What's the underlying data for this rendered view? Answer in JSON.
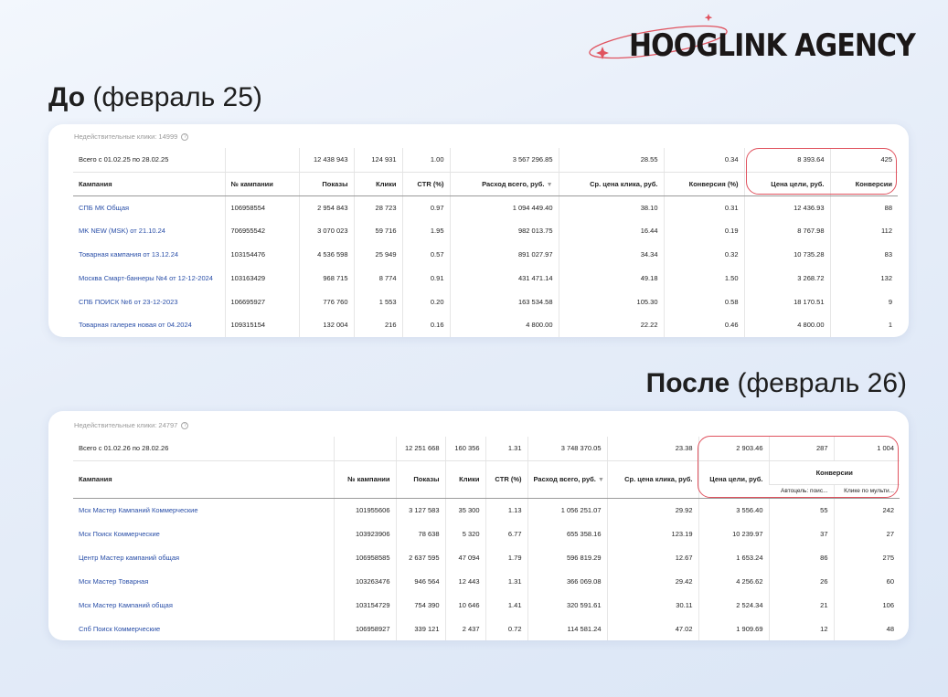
{
  "brand": {
    "name": "HOOGLINK AGENCY",
    "accent": "#e0535f"
  },
  "before": {
    "heading_bold": "До",
    "heading_rest": " (февраль 25)",
    "invalid_clicks": "Недействительные клики: 14999",
    "total": {
      "label": "Всего с 01.02.25 по 28.02.25",
      "shows": "12 438 943",
      "clicks": "124 931",
      "ctr": "1.00",
      "spend": "3 567 296.85",
      "cpc": "28.55",
      "conv_rate": "0.34",
      "goal_cost": "8 393.64",
      "conversions": "425"
    },
    "headers": {
      "campaign": "Кампания",
      "number": "№ кампании",
      "shows": "Показы",
      "clicks": "Клики",
      "ctr": "CTR (%)",
      "spend": "Расход всего, руб.",
      "cpc": "Ср. цена клика, руб.",
      "conv_rate": "Конверсия (%)",
      "goal_cost": "Цена цели, руб.",
      "conversions": "Конверсии"
    },
    "rows": [
      {
        "campaign": "СПБ МК Общая",
        "number": "106958554",
        "shows": "2 954 843",
        "clicks": "28 723",
        "ctr": "0.97",
        "spend": "1 094 449.40",
        "cpc": "38.10",
        "conv_rate": "0.31",
        "goal_cost": "12 436.93",
        "conversions": "88"
      },
      {
        "campaign": "MK NEW (MSK)  от 21.10.24",
        "number": "706955542",
        "shows": "3 070 023",
        "clicks": "59 716",
        "ctr": "1.95",
        "spend": "982 013.75",
        "cpc": "16.44",
        "conv_rate": "0.19",
        "goal_cost": "8 767.98",
        "conversions": "112"
      },
      {
        "campaign": "Товарная кампания  от 13.12.24",
        "number": "103154476",
        "shows": "4 536 598",
        "clicks": "25 949",
        "ctr": "0.57",
        "spend": "891 027.97",
        "cpc": "34.34",
        "conv_rate": "0.32",
        "goal_cost": "10 735.28",
        "conversions": "83"
      },
      {
        "campaign": "Москва Смарт-баннеры №4 от 12-12-2024",
        "number": "103163429",
        "shows": "968 715",
        "clicks": "8 774",
        "ctr": "0.91",
        "spend": "431 471.14",
        "cpc": "49.18",
        "conv_rate": "1.50",
        "goal_cost": "3 268.72",
        "conversions": "132"
      },
      {
        "campaign": "СПБ ПОИСК №6 от 23-12-2023",
        "number": "106695927",
        "shows": "776 760",
        "clicks": "1 553",
        "ctr": "0.20",
        "spend": "163 534.58",
        "cpc": "105.30",
        "conv_rate": "0.58",
        "goal_cost": "18 170.51",
        "conversions": "9"
      },
      {
        "campaign": "Товарная галерея  новая от 04.2024",
        "number": "109315154",
        "shows": "132 004",
        "clicks": "216",
        "ctr": "0.16",
        "spend": "4 800.00",
        "cpc": "22.22",
        "conv_rate": "0.46",
        "goal_cost": "4 800.00",
        "conversions": "1"
      }
    ]
  },
  "after": {
    "heading_bold": "После",
    "heading_rest": " (февраль 26)",
    "invalid_clicks": "Недействительные клики: 24797",
    "total": {
      "label": "Всего с 01.02.26 по 28.02.26",
      "shows": "12 251 668",
      "clicks": "160 356",
      "ctr": "1.31",
      "spend": "3 748 370.05",
      "cpc": "23.38",
      "goal_cost": "2 903.46",
      "conv_autogoal": "287",
      "conv_multi": "1 004"
    },
    "headers": {
      "campaign": "Кампания",
      "number": "№ кампании",
      "shows": "Показы",
      "clicks": "Клики",
      "ctr": "CTR (%)",
      "spend": "Расход всего, руб.",
      "cpc": "Ср. цена клика, руб.",
      "goal_cost": "Цена цели, руб.",
      "conversions": "Конверсии",
      "conv_autogoal": "Автоцель: поис...",
      "conv_multi": "Клике по мульти..."
    },
    "rows": [
      {
        "campaign": "Мск Мастер Кампаний Коммерческие",
        "number": "101955606",
        "shows": "3 127 583",
        "clicks": "35 300",
        "ctr": "1.13",
        "spend": "1 056 251.07",
        "cpc": "29.92",
        "goal_cost": "3 556.40",
        "conv_autogoal": "55",
        "conv_multi": "242"
      },
      {
        "campaign": "Мск Поиск Коммерческие",
        "number": "103923906",
        "shows": "78 638",
        "clicks": "5 320",
        "ctr": "6.77",
        "spend": "655 358.16",
        "cpc": "123.19",
        "goal_cost": "10 239.97",
        "conv_autogoal": "37",
        "conv_multi": "27"
      },
      {
        "campaign": "Центр Мастер кампаний общая",
        "number": "106958585",
        "shows": "2 637 595",
        "clicks": "47 094",
        "ctr": "1.79",
        "spend": "596 819.29",
        "cpc": "12.67",
        "goal_cost": "1 653.24",
        "conv_autogoal": "86",
        "conv_multi": "275"
      },
      {
        "campaign": "Мск Мастер Товарная",
        "number": "103263476",
        "shows": "946 564",
        "clicks": "12 443",
        "ctr": "1.31",
        "spend": "366 069.08",
        "cpc": "29.42",
        "goal_cost": "4 256.62",
        "conv_autogoal": "26",
        "conv_multi": "60"
      },
      {
        "campaign": "Мск Мастер Кампаний общая",
        "number": "103154729",
        "shows": "754 390",
        "clicks": "10 646",
        "ctr": "1.41",
        "spend": "320 591.61",
        "cpc": "30.11",
        "goal_cost": "2 524.34",
        "conv_autogoal": "21",
        "conv_multi": "106"
      },
      {
        "campaign": "Спб Поиск Коммерческие",
        "number": "106958927",
        "shows": "339 121",
        "clicks": "2 437",
        "ctr": "0.72",
        "spend": "114 581.24",
        "cpc": "47.02",
        "goal_cost": "1 909.69",
        "conv_autogoal": "12",
        "conv_multi": "48"
      }
    ]
  }
}
